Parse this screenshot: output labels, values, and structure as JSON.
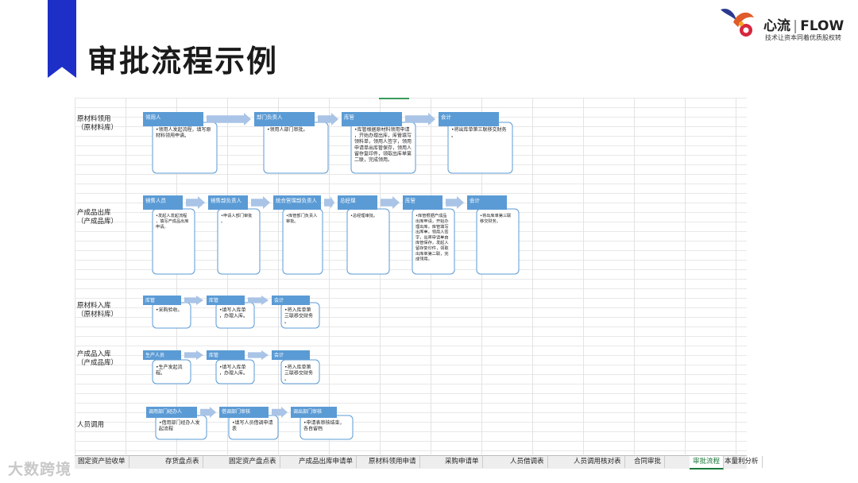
{
  "slide": {
    "title": "审批流程示例"
  },
  "logo": {
    "brand": "心流",
    "brand_en": "FLOW",
    "tagline": "技术让资本同着优质股权转"
  },
  "watermark": "大数跨境",
  "colors": {
    "header_fill": "#5b9bd5",
    "arrow_fill": "#a9c4e6",
    "box_border": "#5b9bd5",
    "active_tab": "#1b7a3b",
    "bookmark": "#1d2fc7"
  },
  "rows": [
    {
      "label": "原材料领用\n（原材料库）",
      "steps": [
        {
          "role": "领用人",
          "desc": "•领用人发起流程，填写原材料领用申请。"
        },
        {
          "role": "部门负责人",
          "desc": "•领用人部门审批。"
        },
        {
          "role": "库管",
          "desc": "•库管根据原材料领用申请，开始办理出库，库管填写领料单，领用人签字，领用申请单出库管保存，领用人留存复印件，领取出库单第二联，完成领用。"
        },
        {
          "role": "会计",
          "desc": "•将出库单第三联移交财务。"
        }
      ]
    },
    {
      "label": "产成品出库\n（产成品库）",
      "steps": [
        {
          "role": "销售人员",
          "desc": "•发起人发起流程，填写产成品出库申请。"
        },
        {
          "role": "销售部负责人",
          "desc": "•申请人部门审批。"
        },
        {
          "role": "统合管理部负责人",
          "desc": "•库管部门负责人审批。"
        },
        {
          "role": "总经理",
          "desc": "•总经理审批。"
        },
        {
          "role": "库管",
          "desc": "•库管根据产成品出库申请，开始办理出库，库管填写出库单，领用人签字，出库申请单由库管保存，发起人留存复印件，领取出库单第二联，完成领用。"
        },
        {
          "role": "会计",
          "desc": "•将出库单第三联移交财务。"
        }
      ]
    },
    {
      "label": "原材料入库\n（原材料库）",
      "steps": [
        {
          "role": "库管",
          "desc": "•采购验收。"
        },
        {
          "role": "库管",
          "desc": "•填写入库单，办理入库。"
        },
        {
          "role": "会计",
          "desc": "•将入库单第三联移交财务。"
        }
      ]
    },
    {
      "label": "产成品入库\n（产成品库）",
      "steps": [
        {
          "role": "生产人员",
          "desc": "•生产发起流程。"
        },
        {
          "role": "库管",
          "desc": "•填写入库单，办理入库。"
        },
        {
          "role": "会计",
          "desc": "•将入库单第三联移交财务。"
        }
      ]
    },
    {
      "label": "人员调用",
      "steps": [
        {
          "role": "调用部门经办人",
          "desc": "•借用部门经办人发起流程"
        },
        {
          "role": "借调部门审核",
          "desc": "•填写人员借调申请表"
        },
        {
          "role": "调出部门审核",
          "desc": "•申请表审核结束，各自留档"
        }
      ]
    }
  ],
  "tabs": [
    "固定资产验收单",
    "存货盘点表",
    "固定资产盘点表",
    "产成品出库申请单",
    "原材料领用申请",
    "采购申请单",
    "人员借调表",
    "人员调用核对表",
    "合同审批",
    "审批流程",
    "本量利分析"
  ],
  "active_tab": "审批流程"
}
